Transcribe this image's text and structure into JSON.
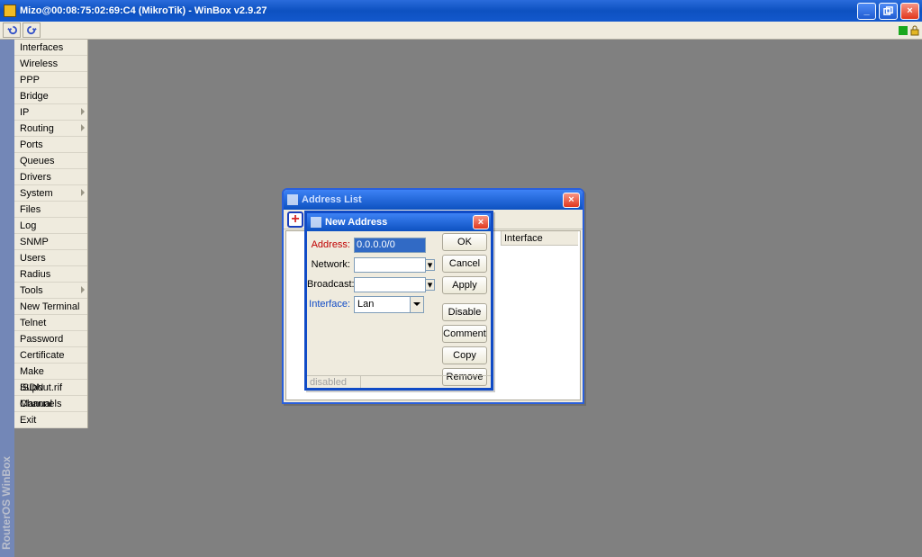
{
  "window": {
    "title": "Mizo@00:08:75:02:69:C4 (MikroTik) - WinBox v2.9.27"
  },
  "vertical_label": "RouterOS WinBox",
  "menu": {
    "items": [
      {
        "label": "Interfaces",
        "expandable": false
      },
      {
        "label": "Wireless",
        "expandable": false
      },
      {
        "label": "PPP",
        "expandable": false
      },
      {
        "label": "Bridge",
        "expandable": false
      },
      {
        "label": "IP",
        "expandable": true
      },
      {
        "label": "Routing",
        "expandable": true
      },
      {
        "label": "Ports",
        "expandable": false
      },
      {
        "label": "Queues",
        "expandable": false
      },
      {
        "label": "Drivers",
        "expandable": false
      },
      {
        "label": "System",
        "expandable": true
      },
      {
        "label": "Files",
        "expandable": false
      },
      {
        "label": "Log",
        "expandable": false
      },
      {
        "label": "SNMP",
        "expandable": false
      },
      {
        "label": "Users",
        "expandable": false
      },
      {
        "label": "Radius",
        "expandable": false
      },
      {
        "label": "Tools",
        "expandable": true
      },
      {
        "label": "New Terminal",
        "expandable": false
      },
      {
        "label": "Telnet",
        "expandable": false
      },
      {
        "label": "Password",
        "expandable": false
      },
      {
        "label": "Certificate",
        "expandable": false
      },
      {
        "label": "Make Supout.rif",
        "expandable": false
      },
      {
        "label": "ISDN Channels",
        "expandable": false
      },
      {
        "label": "Manual",
        "expandable": false
      },
      {
        "label": "Exit",
        "expandable": false
      }
    ]
  },
  "address_list": {
    "title": "Address List",
    "column_interface": "Interface",
    "add_symbol": "+"
  },
  "new_address": {
    "title": "New Address",
    "labels": {
      "address": "Address:",
      "network": "Network:",
      "broadcast": "Broadcast:",
      "interface": "Interface:"
    },
    "values": {
      "address": "0.0.0.0/0",
      "network": "",
      "broadcast": "",
      "interface": "Lan"
    },
    "buttons": {
      "ok": "OK",
      "cancel": "Cancel",
      "apply": "Apply",
      "disable": "Disable",
      "comment": "Comment",
      "copy": "Copy",
      "remove": "Remove"
    },
    "status": "disabled"
  }
}
